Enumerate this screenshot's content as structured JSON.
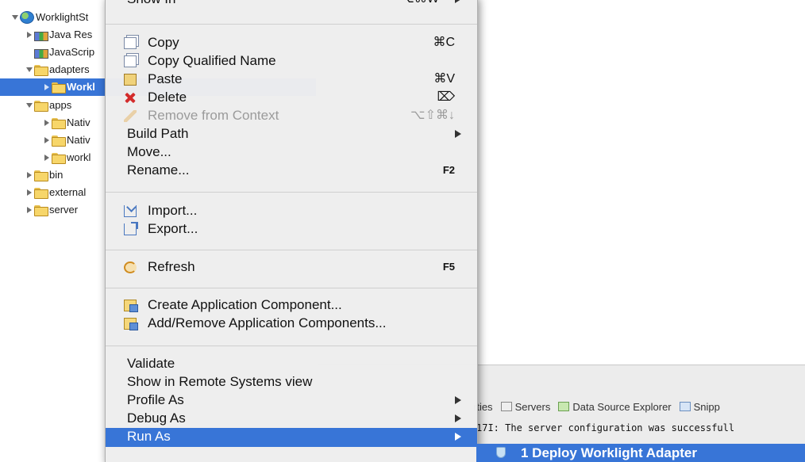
{
  "tree": {
    "items": [
      {
        "label": "WorklightSt",
        "icon": "project-globe-icon",
        "expander": "down"
      },
      {
        "label": "Java Res",
        "icon": "library-icon",
        "expander": "right"
      },
      {
        "label": "JavaScrip",
        "icon": "library-icon",
        "expander": "none"
      },
      {
        "label": "adapters",
        "icon": "folder-icon",
        "expander": "down"
      },
      {
        "label": "Workl",
        "icon": "folder-icon",
        "expander": "right"
      },
      {
        "label": "apps",
        "icon": "folder-icon",
        "expander": "down"
      },
      {
        "label": "Nativ",
        "icon": "folder-icon",
        "expander": "right"
      },
      {
        "label": "Nativ",
        "icon": "folder-icon",
        "expander": "right"
      },
      {
        "label": "workl",
        "icon": "folder-icon",
        "expander": "right"
      },
      {
        "label": "bin",
        "icon": "folder-icon",
        "expander": "right"
      },
      {
        "label": "external",
        "icon": "folder-icon",
        "expander": "right"
      },
      {
        "label": "server",
        "icon": "folder-icon",
        "expander": "right"
      }
    ],
    "selected_index": 4,
    "selection_color": "#3875d7"
  },
  "context_menu": {
    "top_clipped": {
      "label": "Show In",
      "shortcut": "⌥⌘W"
    },
    "items": [
      {
        "label": "Copy",
        "icon": "copy-icon",
        "shortcut": "⌘C"
      },
      {
        "label": "Copy Qualified Name",
        "icon": "copy-qualified-icon"
      },
      {
        "label": "Paste",
        "icon": "paste-icon",
        "shortcut": "⌘V"
      },
      {
        "label": "Delete",
        "icon": "delete-icon",
        "shortcut": "⌦"
      },
      {
        "label": "Remove from Context",
        "icon": "remove-context-icon",
        "shortcut": "⌥⇧⌘↓",
        "disabled": true
      },
      {
        "label": "Build Path",
        "submenu": true
      },
      {
        "label": "Move..."
      },
      {
        "label": "Rename...",
        "shortcut": "F2"
      },
      {
        "label": "Import...",
        "icon": "import-icon"
      },
      {
        "label": "Export...",
        "icon": "export-icon"
      },
      {
        "label": "Refresh",
        "icon": "refresh-icon",
        "shortcut": "F5"
      },
      {
        "label": "Create Application Component...",
        "icon": "component-icon"
      },
      {
        "label": "Add/Remove Application Components...",
        "icon": "component-icon"
      },
      {
        "label": "Validate"
      },
      {
        "label": "Show in Remote Systems view"
      },
      {
        "label": "Profile As",
        "submenu": true
      },
      {
        "label": "Debug As",
        "submenu": true
      },
      {
        "label": "Run As",
        "submenu": true,
        "active": true
      }
    ]
  },
  "submenu": {
    "label": "1 Deploy Worklight Adapter",
    "icon": "worklight-adapter-icon"
  },
  "console": {
    "tabs": [
      {
        "label": "rties",
        "icon": "properties-icon"
      },
      {
        "label": "Servers",
        "icon": "servers-icon"
      },
      {
        "label": "Data Source Explorer",
        "icon": "data-source-icon"
      },
      {
        "label": "Snipp",
        "icon": "snippets-icon"
      }
    ],
    "message": "17I: The server configuration was successfull"
  },
  "colors": {
    "selection": "#3875d7",
    "menu_bg": "#eeeeee"
  }
}
